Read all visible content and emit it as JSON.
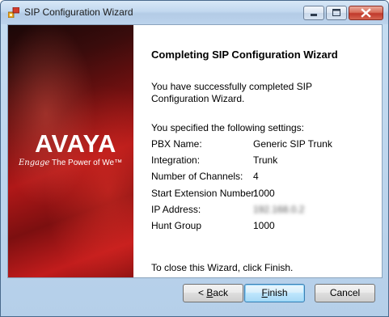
{
  "window": {
    "title": "SIP Configuration Wizard",
    "icon": "sip-config-app-icon",
    "controls": {
      "minimize": "minimize-icon",
      "maximize": "maximize-icon",
      "close": "close-icon"
    }
  },
  "branding": {
    "logo": "AVAYA",
    "tagline_script": "Engage",
    "tagline": "The Power of We™"
  },
  "content": {
    "heading": "Completing SIP Configuration Wizard",
    "intro": "You have successfully completed SIP Configuration Wizard.",
    "settings_title": "You specified the following settings:",
    "settings": [
      {
        "label": "PBX Name:",
        "value": "Generic SIP Trunk"
      },
      {
        "label": "Integration:",
        "value": "Trunk"
      },
      {
        "label": "Number of Channels:",
        "value": "4"
      },
      {
        "label": "Start Extension Number:",
        "value": "1000"
      },
      {
        "label": "IP Address:",
        "value": "192.168.0.2"
      },
      {
        "label": "Hunt Group",
        "value": "1000"
      }
    ],
    "close_note": "To close this Wizard, click Finish."
  },
  "buttons": {
    "back_prefix": "< ",
    "back_mnemonic": "B",
    "back_rest": "ack",
    "finish_mnemonic": "F",
    "finish_rest": "inish",
    "cancel": "Cancel"
  },
  "colors": {
    "brand_red": "#b01818",
    "title_bar": "#c2d8ef",
    "default_button": "#bee6fd"
  }
}
